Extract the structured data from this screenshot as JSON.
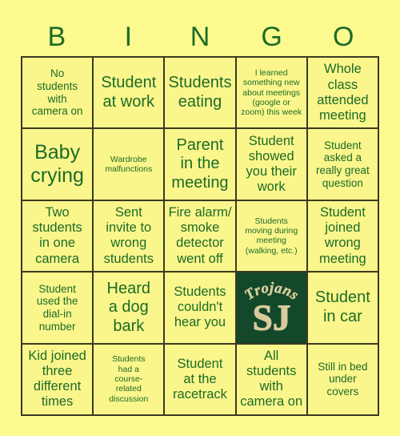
{
  "card": {
    "title": "BINGO",
    "header_letters": [
      "B",
      "I",
      "N",
      "G",
      "O"
    ],
    "colors": {
      "background": "#fcfa8f",
      "cell_background": "#faf68c",
      "text_green": "#1d6b27",
      "grid_line": "#3a3a22",
      "free_space_background": "#13482b",
      "free_space_gold": "#d8cb9a"
    },
    "free_space": {
      "arc_text": "Trojans",
      "monogram": "SJ"
    },
    "rows": [
      [
        {
          "text": "No\nstudents\nwith\ncamera on",
          "size": "sm"
        },
        {
          "text": "Student\nat work",
          "size": "lg"
        },
        {
          "text": "Students\neating",
          "size": "lg"
        },
        {
          "text": "I learned\nsomething new\nabout meetings\n(google or\nzoom) this week",
          "size": "xs"
        },
        {
          "text": "Whole\nclass\nattended\nmeeting",
          "size": "md"
        }
      ],
      [
        {
          "text": "Baby\ncrying",
          "size": "xl"
        },
        {
          "text": "Wardrobe\nmalfunctions",
          "size": "xs"
        },
        {
          "text": "Parent\nin the\nmeeting",
          "size": "lg"
        },
        {
          "text": "Student\nshowed\nyou their\nwork",
          "size": "md"
        },
        {
          "text": "Student\nasked a\nreally great\nquestion",
          "size": "sm"
        }
      ],
      [
        {
          "text": "Two\nstudents\nin one\ncamera",
          "size": "md"
        },
        {
          "text": "Sent\ninvite to\nwrong\nstudents",
          "size": "md"
        },
        {
          "text": "Fire alarm/\nsmoke\ndetector\nwent off",
          "size": "md"
        },
        {
          "text": "Students\nmoving during\nmeeting\n(walking, etc.)",
          "size": "xs"
        },
        {
          "text": "Student\njoined\nwrong\nmeeting",
          "size": "md"
        }
      ],
      [
        {
          "text": "Student\nused the\ndial-in\nnumber",
          "size": "sm"
        },
        {
          "text": "Heard\na dog\nbark",
          "size": "lg"
        },
        {
          "text": "Students\ncouldn't\nhear you",
          "size": "md"
        },
        {
          "text": "",
          "size": "md",
          "free": true
        },
        {
          "text": "Student\nin car",
          "size": "lg"
        }
      ],
      [
        {
          "text": "Kid joined\nthree\ndifferent\ntimes",
          "size": "md"
        },
        {
          "text": "Students\nhad a\ncourse-\nrelated\ndiscussion",
          "size": "xs"
        },
        {
          "text": "Student\nat the\nracetrack",
          "size": "md"
        },
        {
          "text": "All\nstudents\nwith\ncamera on",
          "size": "md"
        },
        {
          "text": "Still in bed\nunder\ncovers",
          "size": "sm"
        }
      ]
    ]
  }
}
